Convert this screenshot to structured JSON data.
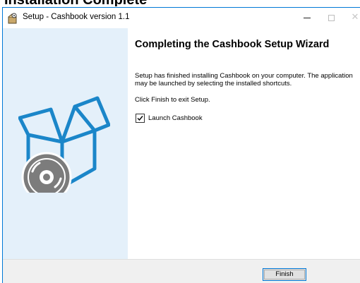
{
  "page": {
    "heading": "Installation Complete"
  },
  "window": {
    "title": "Setup - Cashbook version 1.1",
    "app_icon": "installer-icon",
    "controls": {
      "minimize": "—",
      "maximize": "☐",
      "close": "✕"
    }
  },
  "sidebar": {
    "illustration": "open-box-with-disc-icon",
    "accent_color": "#1b86c9"
  },
  "wizard": {
    "title": "Completing the Cashbook Setup Wizard",
    "description": "Setup has finished installing Cashbook on your computer. The application may be launched by selecting the installed shortcuts.",
    "hint": "Click Finish to exit Setup.",
    "launch_checkbox": {
      "label": "Launch Cashbook",
      "checked": true
    }
  },
  "footer": {
    "finish_label": "Finish"
  },
  "colors": {
    "sidebar_bg": "#e4f0fa",
    "focus_border": "#0078d7",
    "footer_bg": "#f0f0f0"
  }
}
